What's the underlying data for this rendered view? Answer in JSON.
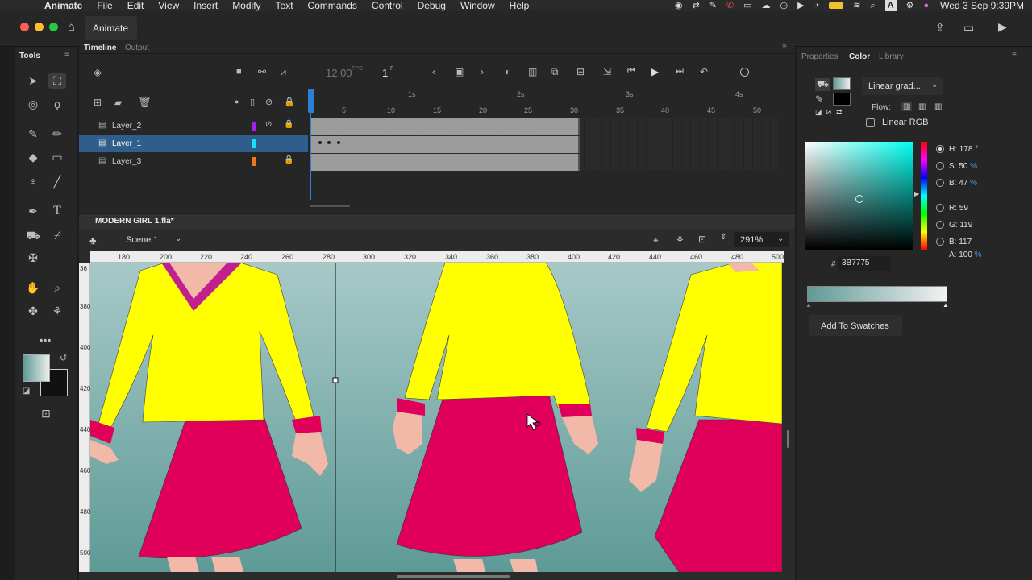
{
  "menubar": {
    "app_name": "Animate",
    "items": [
      "File",
      "Edit",
      "View",
      "Insert",
      "Modify",
      "Text",
      "Commands",
      "Control",
      "Debug",
      "Window",
      "Help"
    ],
    "clock": "Wed 3 Sep 9:39PM"
  },
  "window": {
    "title": "Animate"
  },
  "tools_panel": {
    "title": "Tools"
  },
  "timeline": {
    "tab_timeline": "Timeline",
    "tab_output": "Output",
    "fps": "12.00",
    "fps_unit": "FPS",
    "current_frame": "1",
    "frame_unit": "F",
    "seconds": [
      "1s",
      "2s",
      "3s",
      "4s"
    ],
    "frame_numbers": [
      "5",
      "10",
      "15",
      "20",
      "25",
      "30",
      "35",
      "40",
      "45",
      "50"
    ],
    "layers": [
      {
        "name": "Layer_2",
        "color": "#a020f0",
        "selected": false
      },
      {
        "name": "Layer_1",
        "color": "#19e0f0",
        "selected": true
      },
      {
        "name": "Layer_3",
        "color": "#f07818",
        "selected": false
      }
    ]
  },
  "document": {
    "filename": "MODERN GIRL 1.fla*",
    "scene": "Scene 1",
    "zoom": "291%",
    "ruler_top": [
      "180",
      "200",
      "220",
      "240",
      "260",
      "280",
      "300",
      "320",
      "340",
      "360",
      "380",
      "400",
      "420",
      "440",
      "460",
      "480",
      "500"
    ],
    "ruler_left": [
      "36",
      "380",
      "400",
      "420",
      "440",
      "460",
      "480",
      "500"
    ]
  },
  "right_panel": {
    "tab_properties": "Properties",
    "tab_color": "Color",
    "tab_library": "Library",
    "fill_type": "Linear grad...",
    "flow_label": "Flow:",
    "linear_rgb_label": "Linear RGB",
    "hue_label": "H:",
    "hue_value": "178",
    "hue_unit": "°",
    "sat_label": "S:",
    "sat_value": "50",
    "bri_label": "B:",
    "bri_value": "47",
    "pct": "%",
    "r_label": "R:",
    "r_value": "59",
    "g_label": "G:",
    "g_value": "119",
    "b_label": "B:",
    "b_value": "117",
    "a_label": "A:",
    "a_value": "100",
    "hash": "#",
    "hex_value": "3B7775",
    "add_swatches": "Add To Swatches"
  },
  "colors": {
    "stage_bg_top": "#a7c9c7",
    "stage_bg_bottom": "#5e9a96",
    "shirt": "#ffff00",
    "skirt": "#e0005a",
    "skin": "#f3b9a8",
    "accent": "#3b7775"
  }
}
